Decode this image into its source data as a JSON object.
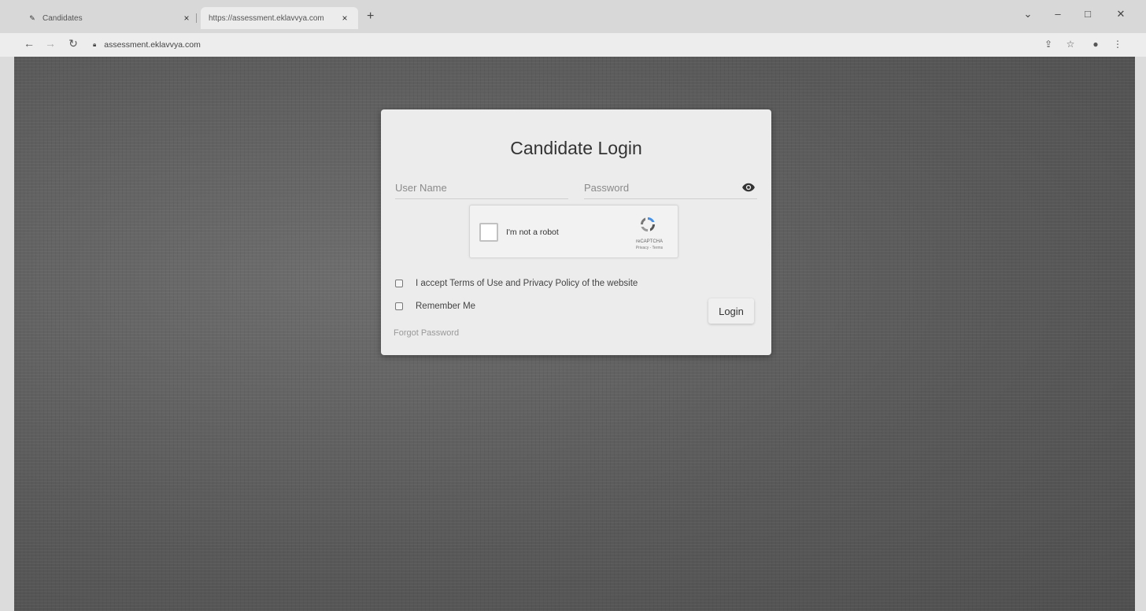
{
  "browser": {
    "tabs": [
      {
        "label": "Candidates",
        "active": false
      },
      {
        "label": "https://assessment.eklavvya.com",
        "active": true
      }
    ],
    "new_tab_label": "+",
    "window_controls": {
      "dropdown": "⌄",
      "minimize": "–",
      "restore": "□",
      "close": "✕"
    },
    "url": "assessment.eklavvya.com",
    "tab_close": "×"
  },
  "login": {
    "title": "Candidate Login",
    "username_placeholder": "User Name",
    "password_placeholder": "Password",
    "captcha": {
      "label": "I'm not a robot",
      "brand": "reCAPTCHA",
      "links": "Privacy - Terms"
    },
    "terms_label": "I accept Terms of Use and Privacy Policy of the website",
    "remember_label": "Remember Me",
    "login_button": "Login",
    "forgot_password": "Forgot Password"
  },
  "colors": {
    "background": "#5e5e5e",
    "card": "#ececec",
    "captcha_blue": "#4a90e2"
  }
}
